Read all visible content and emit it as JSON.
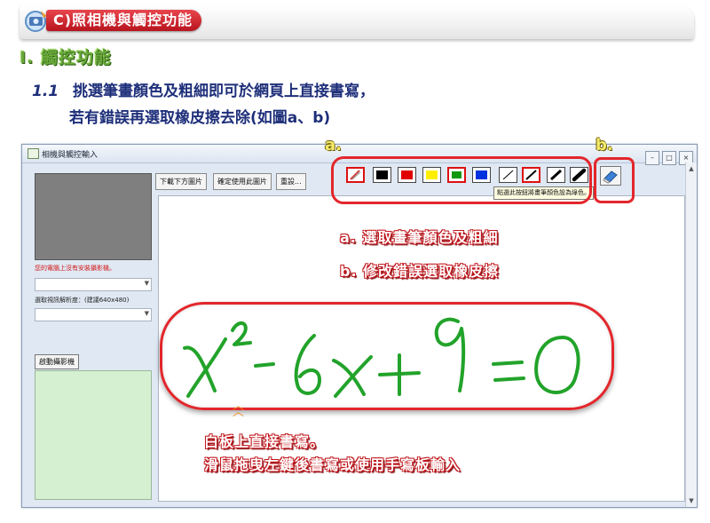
{
  "header": {
    "badge": "C)照相機與觸控功能",
    "subheading": "I. 觸控功能",
    "step_number": "1.1",
    "line1": "挑選筆畫顏色及粗細即可於網頁上直接書寫，",
    "line2": "若有錯誤再選取橡皮擦去除(如圖a、b)"
  },
  "window": {
    "title": "相機與觸控輸入",
    "camera_message": "您的電腦上沒有安裝攝影機。",
    "resolution_label": "選取視訊解析度：(建議640x480)",
    "start_button": "啟動攝影機",
    "buttons": [
      "下載下方圖片",
      "確定使用此圖片",
      "重設..."
    ],
    "tooltip": "點選此按鈕將畫筆顏色設為綠色。",
    "pen_colors": [
      "#000000",
      "#e00000",
      "#ffee00",
      "#119911",
      "#0033dd"
    ],
    "pen_widths": [
      "thin",
      "medium",
      "thick",
      "extra-thick"
    ]
  },
  "annotations": {
    "label_a": "a.",
    "label_b": "b.",
    "note_a": "a. 選取畫筆顏色及粗細",
    "note_b": "b. 修改錯誤選取橡皮擦",
    "whiteboard_line1": "白板上直接書寫。",
    "whiteboard_line2": "滑鼠拖曳左鍵後書寫或使用手寫板輸入"
  },
  "colors": {
    "accent_red": "#e3262b",
    "heading_green": "#6aa93a",
    "text_navy": "#1e2f7a",
    "ink_green": "#22a32a"
  }
}
